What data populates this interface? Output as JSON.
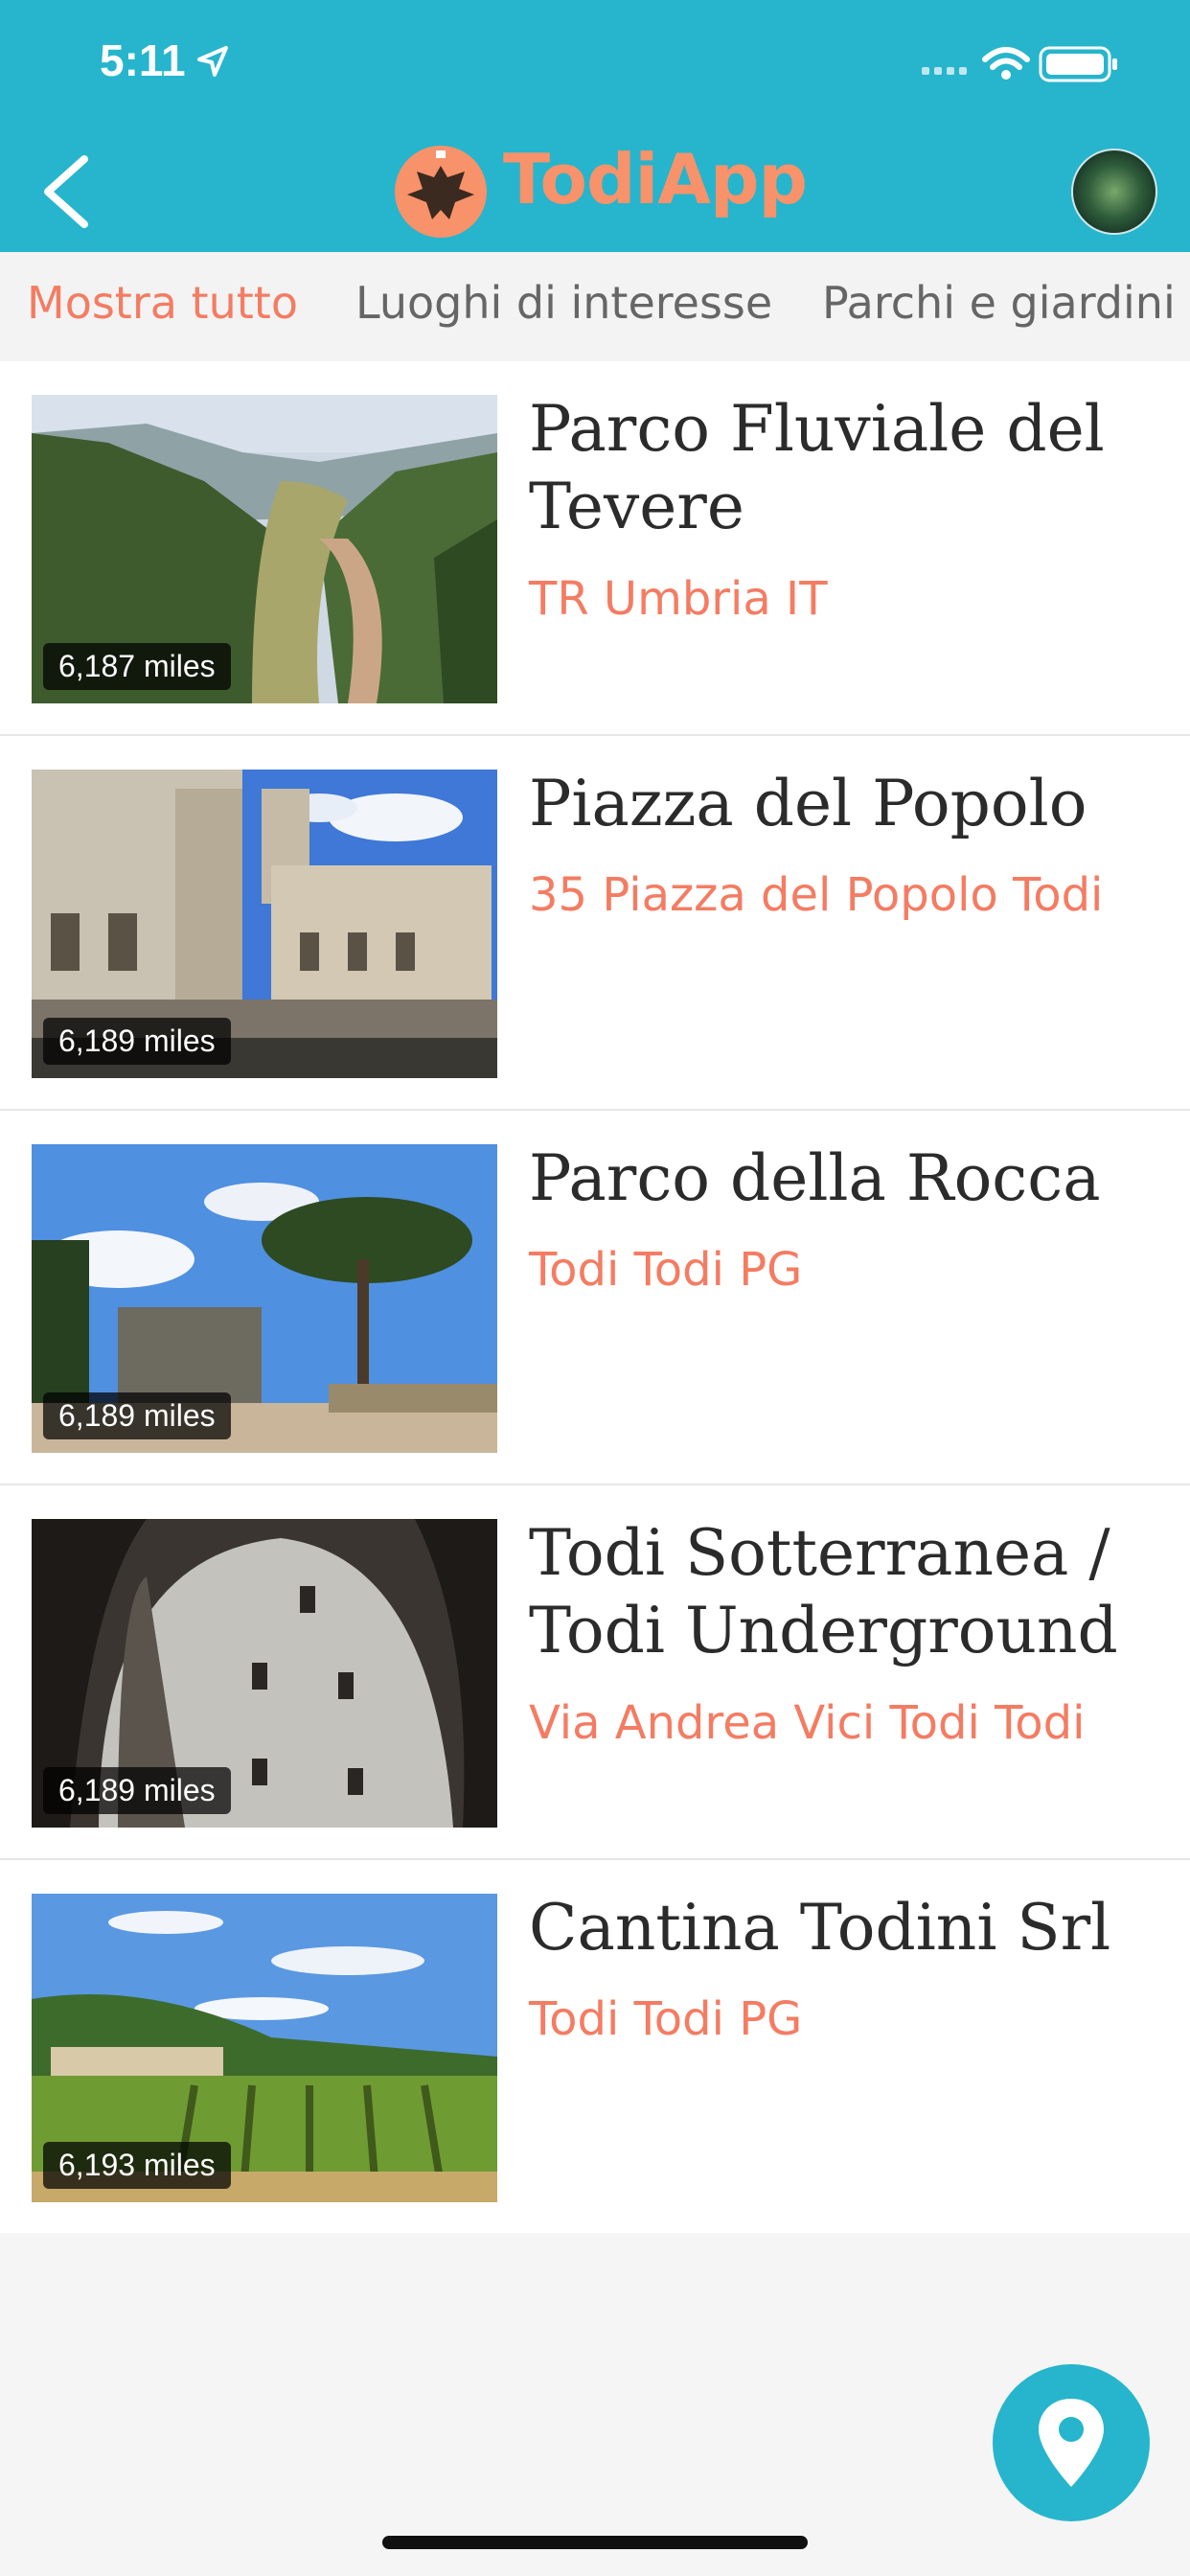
{
  "status_bar": {
    "time": "5:11"
  },
  "header": {
    "app_name": "TodiApp"
  },
  "tabs": [
    {
      "label": "Mostra tutto",
      "active": true
    },
    {
      "label": "Luoghi di interesse",
      "active": false
    },
    {
      "label": "Parchi e giardini",
      "active": false
    }
  ],
  "places": [
    {
      "title": "Parco Fluviale del Tevere",
      "address": "TR Umbria IT",
      "distance": "6,187 miles"
    },
    {
      "title": "Piazza del Popolo",
      "address": "35 Piazza del Popolo Todi",
      "distance": "6,189 miles"
    },
    {
      "title": "Parco della Rocca",
      "address": "Todi Todi PG",
      "distance": "6,189 miles"
    },
    {
      "title": "Todi Sotterranea / Todi Underground",
      "address": "Via Andrea Vici Todi Todi",
      "distance": "6,189 miles"
    },
    {
      "title": "Cantina Todini Srl",
      "address": "Todi Todi PG",
      "distance": "6,193 miles"
    }
  ],
  "colors": {
    "brand": "#26b5cc",
    "accent": "#f47c62"
  }
}
